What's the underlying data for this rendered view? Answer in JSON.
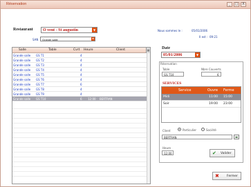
{
  "window": {
    "title": "Réservation",
    "controls": [
      "_",
      "□",
      "X"
    ]
  },
  "restaurant": {
    "label": "Restaurant",
    "value": "O vent - St augustin"
  },
  "salle": {
    "tag": "SAN",
    "value": "Grande salle"
  },
  "grid": {
    "columns": [
      "Salle",
      "Table",
      "Cvrt",
      "Heure",
      "Client"
    ],
    "rows": [
      {
        "salle": "Grande salle",
        "table": "GS T1",
        "cvrt": "4",
        "heure": "",
        "client": "",
        "selected": false
      },
      {
        "salle": "Grande salle",
        "table": "GS T2",
        "cvrt": "4",
        "heure": "",
        "client": "",
        "selected": false
      },
      {
        "salle": "Grande salle",
        "table": "GS T3",
        "cvrt": "4",
        "heure": "",
        "client": "",
        "selected": false
      },
      {
        "salle": "Grande salle",
        "table": "GS T4",
        "cvrt": "4",
        "heure": "",
        "client": "",
        "selected": false
      },
      {
        "salle": "Grande salle",
        "table": "GS T5",
        "cvrt": "4",
        "heure": "",
        "client": "",
        "selected": false
      },
      {
        "salle": "Grande salle",
        "table": "GS T6",
        "cvrt": "4",
        "heure": "",
        "client": "",
        "selected": false
      },
      {
        "salle": "Grande salle",
        "table": "GS T7",
        "cvrt": "6",
        "heure": "",
        "client": "",
        "selected": false
      },
      {
        "salle": "Grande salle",
        "table": "GS T8",
        "cvrt": "4",
        "heure": "",
        "client": "",
        "selected": false
      },
      {
        "salle": "Grande salle",
        "table": "GS T9",
        "cvrt": "4",
        "heure": "",
        "client": "",
        "selected": false
      },
      {
        "salle": "Grande salle",
        "table": "GS T10",
        "cvrt": "6",
        "heure": "12:00",
        "client": "BERTRAN",
        "selected": true
      }
    ],
    "empty_rows": 15
  },
  "today": {
    "label": "Nous sommes le :",
    "date": "05/01/2006",
    "time_label": "Il est :",
    "time": "09:21"
  },
  "date": {
    "label": "Date",
    "value": "05/01/2006"
  },
  "reservation": {
    "label": "Réservation",
    "table_label": "Table",
    "table_value": "GS T10",
    "covers_label": "Nbre Couverts",
    "covers_value": "6"
  },
  "services": {
    "title": "SERVICES",
    "columns": [
      "Service",
      "Ouvre",
      "Ferme"
    ],
    "rows": [
      {
        "service": "Midi",
        "ouvre": "11:00",
        "ferme": "15:00",
        "selected": true
      },
      {
        "service": "Soir",
        "ouvre": "19:00",
        "ferme": "23:00",
        "selected": false
      }
    ]
  },
  "client": {
    "label": "Client",
    "option_particulier": "Particulier",
    "option_societe": "Société",
    "selected_option": "particulier",
    "value": "BERTRAN"
  },
  "heure": {
    "label": "Heure",
    "value": "12:00"
  },
  "buttons": {
    "valider": "Valider",
    "fermer": "Fermer"
  },
  "colors": {
    "accent": "#e05818",
    "title_red": "#c0201a",
    "link_blue": "#1a3ac0",
    "selection": "#a6a6b0"
  },
  "icons": {
    "valider": "check-icon",
    "fermer": "cross-icon",
    "lookup": "lookup-icon"
  }
}
